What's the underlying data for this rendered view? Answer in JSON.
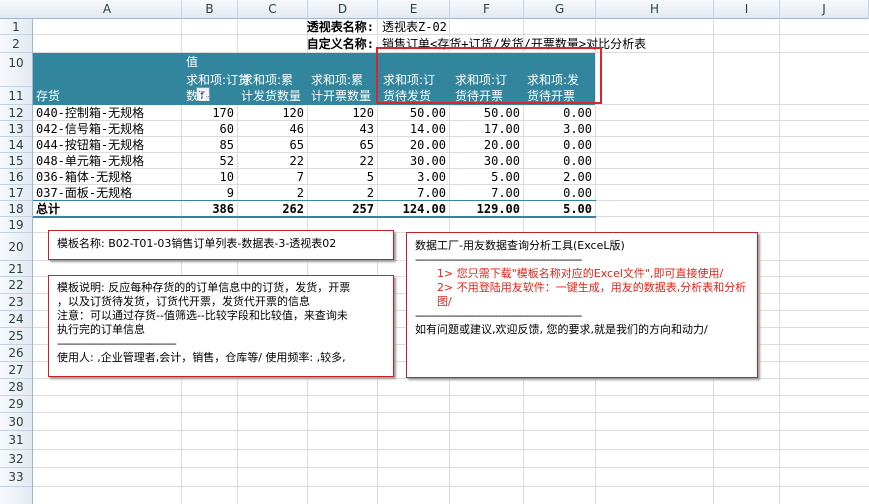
{
  "columns": [
    "A",
    "B",
    "C",
    "D",
    "E",
    "F",
    "G",
    "H",
    "I",
    "J"
  ],
  "rows": [
    "1",
    "2",
    "10",
    "11",
    "12",
    "13",
    "14",
    "15",
    "16",
    "17",
    "18",
    "19",
    "20",
    "21",
    "22",
    "23",
    "24",
    "25",
    "26",
    "27",
    "28",
    "29",
    "30",
    "31",
    "32",
    "33"
  ],
  "title": {
    "label1": "透视表名称:",
    "value1": "透视表Z-02",
    "label2": "自定义名称:",
    "value2": "销售订单<存货+订货/发货/开票数量>对比分析表"
  },
  "pivot": {
    "row_label": "存货",
    "values_label": "值",
    "headers": [
      [
        "求和项:订货",
        "数量"
      ],
      [
        "求和项:累",
        "计发货数量"
      ],
      [
        "求和项:累",
        "计开票数量"
      ],
      [
        "求和项:订",
        "货待发货"
      ],
      [
        "求和项:订",
        "货待开票"
      ],
      [
        "求和项:发",
        "货待开票"
      ]
    ],
    "rows": [
      {
        "name": "040-控制箱-无规格",
        "v": [
          "170",
          "120",
          "120",
          "50.00",
          "50.00",
          "0.00"
        ]
      },
      {
        "name": "042-信号箱-无规格",
        "v": [
          "60",
          "46",
          "43",
          "14.00",
          "17.00",
          "3.00"
        ]
      },
      {
        "name": "044-按钮箱-无规格",
        "v": [
          "85",
          "65",
          "65",
          "20.00",
          "20.00",
          "0.00"
        ]
      },
      {
        "name": "048-单元箱-无规格",
        "v": [
          "52",
          "22",
          "22",
          "30.00",
          "30.00",
          "0.00"
        ]
      },
      {
        "name": "036-箱体-无规格",
        "v": [
          "10",
          "7",
          "5",
          "3.00",
          "5.00",
          "2.00"
        ]
      },
      {
        "name": "037-面板-无规格",
        "v": [
          "9",
          "2",
          "2",
          "7.00",
          "7.00",
          "0.00"
        ]
      }
    ],
    "total": {
      "name": "总计",
      "v": [
        "386",
        "262",
        "257",
        "124.00",
        "129.00",
        "5.00"
      ]
    }
  },
  "notes": {
    "template_name": "模板名称:   B02-T01-03销售订单列表-数据表-3-透视表02",
    "desc_lines": [
      "模板说明: 反应每种存货的的订单信息中的订货，发货，开票",
      "，以及订货待发货，订货代开票，发货代开票的信息",
      "注意：可以通过存货--值筛选--比较字段和比较值，来查询未",
      "执行完的订单信息",
      "----------------------------------------",
      "使用人: ,企业管理者,会计，销售，仓库等/      使用频率: ,较多,"
    ],
    "tool_title": "数据工厂-用友数据查询分析工具(ExceL版)",
    "tool_dash": "--------------------------------------------------------",
    "tool_red1": "1> 您只需下载\"模板名称对应的Excel文件\",即可直接使用/",
    "tool_red2": "2> 不用登陆用友软件：一键生成，用友的数据表,分析表和分析图/",
    "tool_dash2": "--------------------------------------------------------",
    "tool_footer": "如有问题或建议,欢迎反馈, 您的要求,就是我们的方向和动力/"
  },
  "colors": {
    "header_teal": "#31859c",
    "highlight": "#d9262c"
  }
}
